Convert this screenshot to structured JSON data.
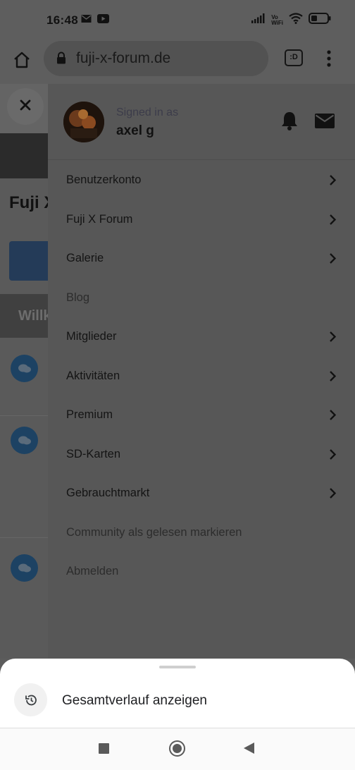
{
  "status_bar": {
    "time": "16:48",
    "icons": [
      "mail-icon",
      "youtube-icon",
      "signal-icon",
      "vowifi-icon",
      "wifi-icon",
      "battery-icon"
    ],
    "vowifi_text_top": "Vo",
    "vowifi_text_bottom": "WiFi"
  },
  "browser": {
    "url": "fuji-x-forum.de",
    "tabs_label": ":D"
  },
  "background_page": {
    "title_fragment": "Fuji X",
    "banner_fragment": "Willk"
  },
  "drawer": {
    "signed_in_label": "Signed in as",
    "username": "axel g",
    "menu_items": [
      {
        "label": "Benutzerkonto",
        "has_submenu": true
      },
      {
        "label": "Fuji X Forum",
        "has_submenu": true
      },
      {
        "label": "Galerie",
        "has_submenu": true
      },
      {
        "label": "Blog",
        "has_submenu": false
      },
      {
        "label": "Mitglieder",
        "has_submenu": true
      },
      {
        "label": "Aktivitäten",
        "has_submenu": true
      },
      {
        "label": "Premium",
        "has_submenu": true
      },
      {
        "label": "SD-Karten",
        "has_submenu": true
      },
      {
        "label": "Gebrauchtmarkt",
        "has_submenu": true
      },
      {
        "label": "Community als gelesen markieren",
        "has_submenu": false
      },
      {
        "label": "Abmelden",
        "has_submenu": false
      }
    ]
  },
  "bottom_sheet": {
    "history_label": "Gesamtverlauf anzeigen"
  },
  "colors": {
    "overlay_bg": "#5a5a5a",
    "drawer_bg": "#575757",
    "sheet_bg": "#ffffff",
    "bubble_blue": "#1d4263"
  }
}
